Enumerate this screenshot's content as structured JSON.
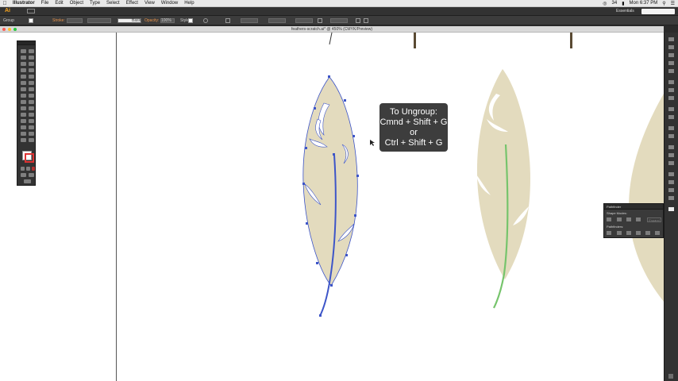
{
  "menubar": {
    "apple": "",
    "items": [
      "Illustrator",
      "File",
      "Edit",
      "Object",
      "Type",
      "Select",
      "Effect",
      "View",
      "Window",
      "Help"
    ],
    "battery": "34",
    "clock": "Mon 6:37 PM"
  },
  "appbar": {
    "logo": "Ai",
    "workspace": "Essentials"
  },
  "controlbar": {
    "selection_label": "Group",
    "stroke_label": "Stroke:",
    "brush_label": "Basic",
    "opacity_label": "Opacity:",
    "opacity_value": "100%",
    "style_label": "Style:"
  },
  "document": {
    "tab_title": "feathers-scratch.ai* @ 450% (CMYK/Preview)"
  },
  "tooltip": {
    "line1": "To Ungroup:",
    "line2": "Cmnd + Shift + G",
    "line3": "or",
    "line4": "Ctrl + Shift + G"
  },
  "pathfinder": {
    "title": "Pathfinder",
    "shape_modes": "Shape Modes:",
    "pathfinders": "Pathfinders:",
    "expand": "Expand"
  },
  "colors": {
    "feather_fill": "#e3dbbe",
    "selection_blue": "#3d55c8",
    "quill_green": "#76c46c",
    "menu_bg": "#e8e8e8",
    "ui_dark": "#323232"
  }
}
